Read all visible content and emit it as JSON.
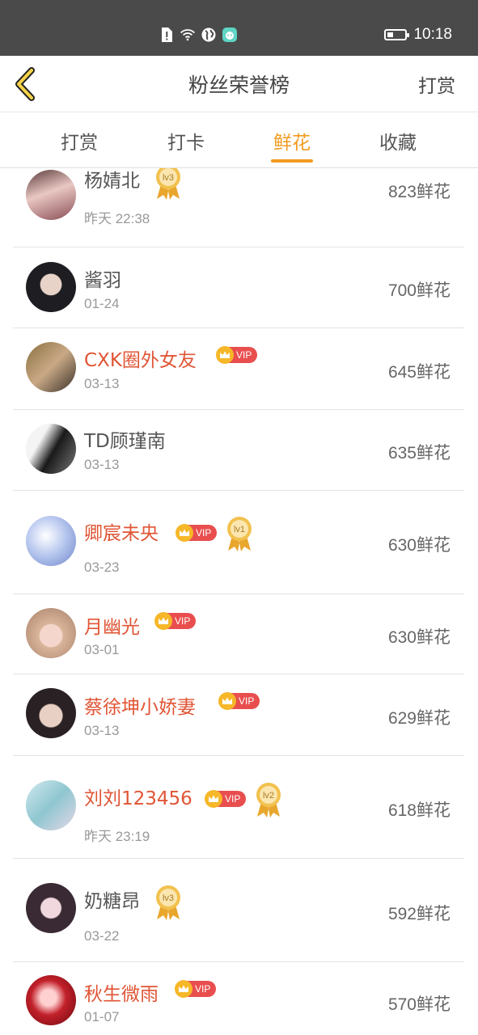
{
  "status_bar": {
    "time": "10:18",
    "icons": [
      "sim-alert-icon",
      "wifi-icon",
      "globe-icon",
      "app-notification-icon",
      "battery-icon"
    ]
  },
  "header": {
    "title": "粉丝荣誉榜",
    "action": "打赏"
  },
  "tabs": [
    {
      "label": "打赏",
      "active": false
    },
    {
      "label": "打卡",
      "active": false
    },
    {
      "label": "鲜花",
      "active": true
    },
    {
      "label": "收藏",
      "active": false
    }
  ],
  "accent_color": "#f29b21",
  "vip_name_color": "#e05535",
  "vip_label": "VIP",
  "fans": [
    {
      "name": "杨婧北",
      "date": "昨天 22:38",
      "count": "823鲜花",
      "vip": false,
      "level": "lv3"
    },
    {
      "name": "酱羽",
      "date": "01-24",
      "count": "700鲜花",
      "vip": false,
      "level": ""
    },
    {
      "name": "CXK圈外女友",
      "date": "03-13",
      "count": "645鲜花",
      "vip": true,
      "level": ""
    },
    {
      "name": "TD顾瑾南",
      "date": "03-13",
      "count": "635鲜花",
      "vip": false,
      "level": ""
    },
    {
      "name": "卿宸未央",
      "date": "03-23",
      "count": "630鲜花",
      "vip": true,
      "level": "lv1"
    },
    {
      "name": "月幽光",
      "date": "03-01",
      "count": "630鲜花",
      "vip": true,
      "level": ""
    },
    {
      "name": "蔡徐坤小娇妻",
      "date": "03-13",
      "count": "629鲜花",
      "vip": true,
      "level": ""
    },
    {
      "name": "刘刘123456",
      "date": "昨天 23:19",
      "count": "618鲜花",
      "vip": true,
      "level": "lv2"
    },
    {
      "name": "奶糖昂",
      "date": "03-22",
      "count": "592鲜花",
      "vip": false,
      "level": "lv3"
    },
    {
      "name": "秋生微雨",
      "date": "01-07",
      "count": "570鲜花",
      "vip": true,
      "level": ""
    }
  ]
}
